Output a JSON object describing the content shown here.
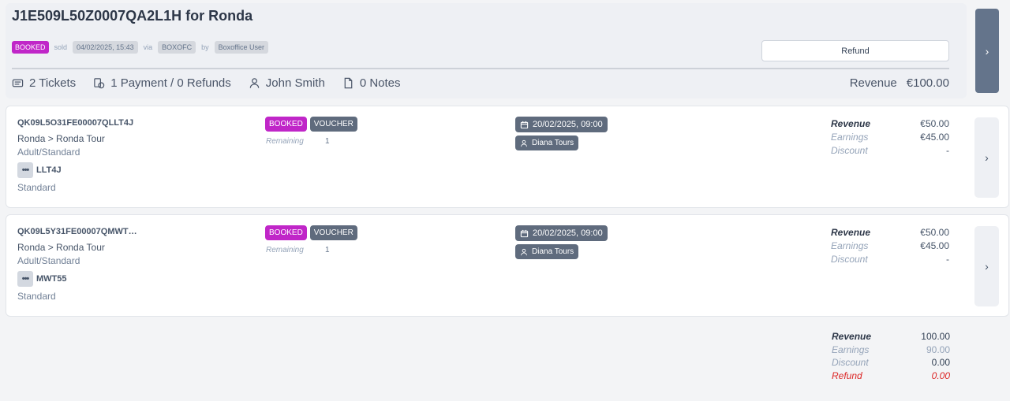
{
  "header": {
    "title": "J1E509L50Z0007QA2L1H for Ronda",
    "status_badge": "BOOKED",
    "sold_label": "sold",
    "sold_date": "04/02/2025, 15:43",
    "via_label": "via",
    "channel": "BOXOFC",
    "by_label": "by",
    "user": "Boxoffice User",
    "refund_button": "Refund"
  },
  "stats": {
    "tickets": "2 Tickets",
    "payments": "1 Payment / 0 Refunds",
    "customer": "John Smith",
    "notes": "0 Notes",
    "revenue_label": "Revenue",
    "revenue_value": "€100.00"
  },
  "tickets": [
    {
      "code": "QK09L5O31FE00007QLLT4J",
      "tour": "Ronda > Ronda Tour",
      "type": "Adult/Standard",
      "short_code": "LLT4J",
      "variant": "Standard",
      "status": "BOOKED",
      "kind": "VOUCHER",
      "remaining_label": "Remaining",
      "remaining_value": "1",
      "datetime": "20/02/2025, 09:00",
      "guide": "Diana Tours",
      "revenue_label": "Revenue",
      "revenue": "€50.00",
      "earnings_label": "Earnings",
      "earnings": "€45.00",
      "discount_label": "Discount",
      "discount": "-"
    },
    {
      "code": "QK09L5Y31FE00007QMWT…",
      "tour": "Ronda > Ronda Tour",
      "type": "Adult/Standard",
      "short_code": "MWT55",
      "variant": "Standard",
      "status": "BOOKED",
      "kind": "VOUCHER",
      "remaining_label": "Remaining",
      "remaining_value": "1",
      "datetime": "20/02/2025, 09:00",
      "guide": "Diana Tours",
      "revenue_label": "Revenue",
      "revenue": "€50.00",
      "earnings_label": "Earnings",
      "earnings": "€45.00",
      "discount_label": "Discount",
      "discount": "-"
    }
  ],
  "summary": {
    "revenue_label": "Revenue",
    "revenue": "100.00",
    "earnings_label": "Earnings",
    "earnings": "90.00",
    "discount_label": "Discount",
    "discount": "0.00",
    "refund_label": "Refund",
    "refund": "0.00"
  },
  "colors": {
    "booked_badge": "#c026c8",
    "voucher_badge": "#5f6b7d",
    "refund_red": "#dc2626"
  },
  "icons": {
    "side_button": "chevron-right-icon",
    "row_button": "chevron-right-icon",
    "tickets": "ticket-icon",
    "payments": "coins-icon",
    "customer": "user-icon",
    "notes": "document-icon",
    "date": "calendar-icon",
    "guide": "user-icon",
    "code_menu": "more-dots-icon"
  }
}
